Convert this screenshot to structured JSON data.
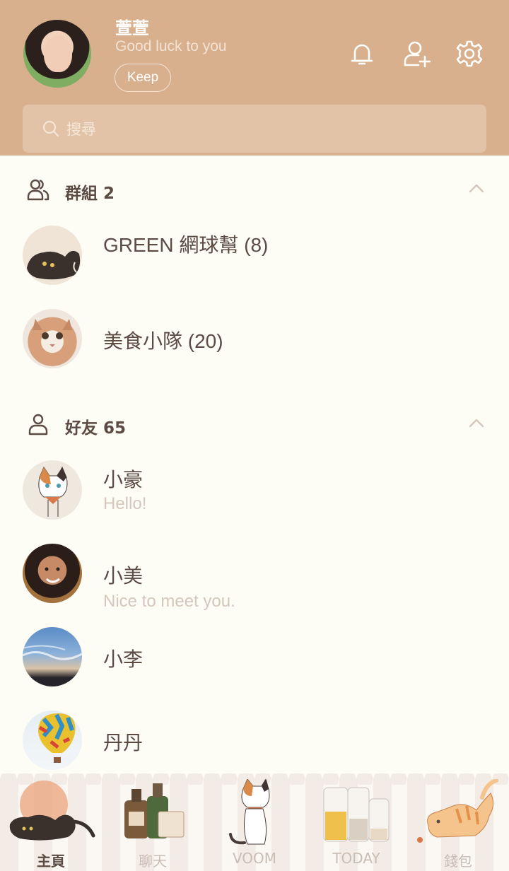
{
  "profile": {
    "name": "萱萱",
    "status": "Good luck to you",
    "keep_label": "Keep"
  },
  "header_icons": [
    "bell-icon",
    "add-friend-icon",
    "settings-gear-icon"
  ],
  "search": {
    "placeholder": "搜尋"
  },
  "groups": {
    "title": "群組 2",
    "items": [
      {
        "name": "GREEN 網球幫 (8)"
      },
      {
        "name": "美食小隊 (20)"
      }
    ]
  },
  "friends": {
    "title": "好友 65",
    "items": [
      {
        "name": "小豪",
        "message": "Hello!"
      },
      {
        "name": "小美",
        "message": "Nice to meet you."
      },
      {
        "name": "小李"
      },
      {
        "name": "丹丹"
      }
    ]
  },
  "tabs": [
    {
      "label": "主頁",
      "active": true
    },
    {
      "label": "聊天"
    },
    {
      "label": "VOOM"
    },
    {
      "label": "TODAY"
    },
    {
      "label": "錢包"
    }
  ],
  "colors": {
    "header": "#d8b08d",
    "background": "#fdfcf5",
    "text": "#5b4b43",
    "muted_text": "#d5c7bb"
  }
}
